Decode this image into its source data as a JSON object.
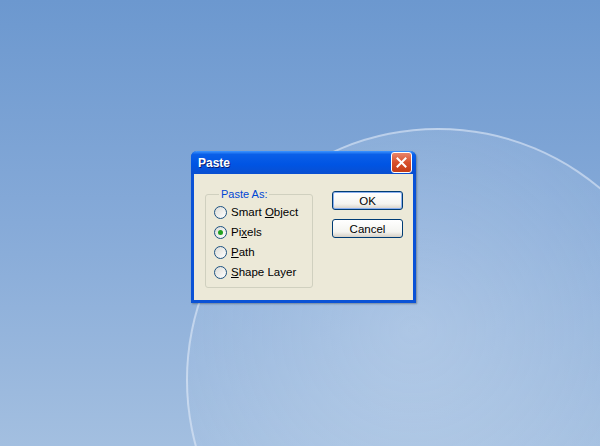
{
  "window": {
    "title": "Paste"
  },
  "group": {
    "legend": "Paste As:"
  },
  "options": [
    {
      "label": "Smart Object",
      "access_key": "O",
      "selected": false
    },
    {
      "label": "Pixels",
      "access_key": "x",
      "selected": true
    },
    {
      "label": "Path",
      "access_key": "P",
      "selected": false
    },
    {
      "label": "Shape Layer",
      "access_key": "S",
      "selected": false
    }
  ],
  "buttons": [
    {
      "label": "OK",
      "default": true
    },
    {
      "label": "Cancel",
      "default": false
    }
  ]
}
